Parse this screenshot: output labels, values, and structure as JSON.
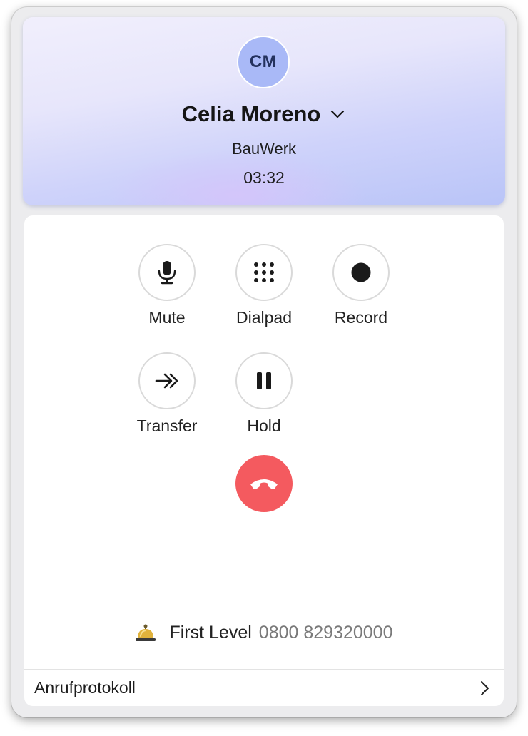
{
  "caller": {
    "initials": "CM",
    "name": "Celia Moreno",
    "company": "BauWerk",
    "duration": "03:32"
  },
  "controls": [
    {
      "label": "Mute",
      "icon": "microphone-icon"
    },
    {
      "label": "Dialpad",
      "icon": "dialpad-icon"
    },
    {
      "label": "Record",
      "icon": "record-icon"
    },
    {
      "label": "Transfer",
      "icon": "transfer-icon"
    },
    {
      "label": "Hold",
      "icon": "pause-icon"
    }
  ],
  "end_call": {
    "icon": "hang-up-icon",
    "color": "#f45a5f"
  },
  "queue": {
    "icon": "bell-icon",
    "name": "First Level",
    "number": "0800 829320000"
  },
  "call_log": {
    "label": "Anrufprotokoll",
    "icon": "chevron-right-icon"
  },
  "colors": {
    "avatar_bg": "#a9b9f7",
    "header_gradient_end": "#b9c4f8",
    "end_call_red": "#f45a5f"
  }
}
